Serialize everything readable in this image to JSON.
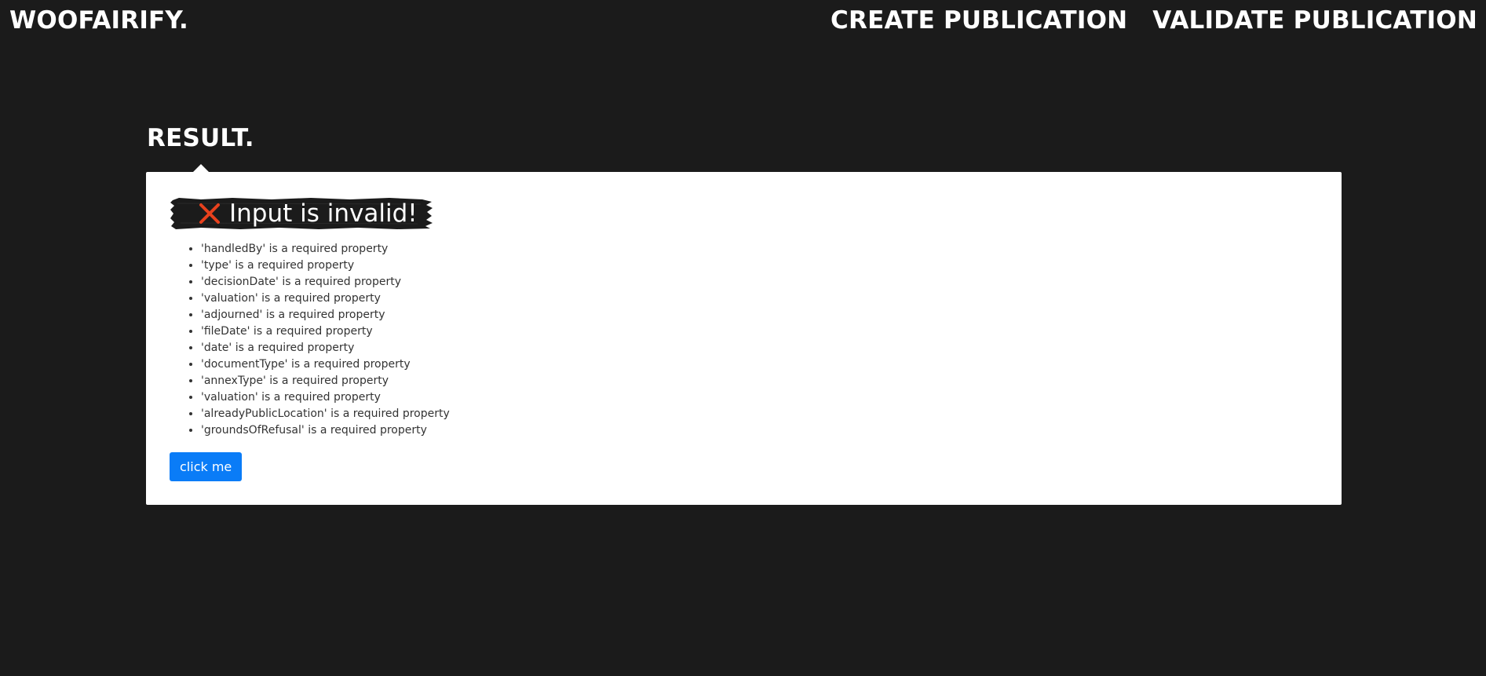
{
  "app": {
    "brand": "WOOFAIRIFY."
  },
  "nav": {
    "items": [
      {
        "label": "CREATE PUBLICATION"
      },
      {
        "label": "VALIDATE PUBLICATION"
      }
    ]
  },
  "result": {
    "heading": "RESULT.",
    "status": {
      "icon": "cross-icon",
      "text": "Input is invalid!",
      "icon_color": "#e8411d"
    },
    "errors": [
      "'handledBy' is a required property",
      "'type' is a required property",
      "'decisionDate' is a required property",
      "'valuation' is a required property",
      "'adjourned' is a required property",
      "'fileDate' is a required property",
      "'date' is a required property",
      "'documentType' is a required property",
      "'annexType' is a required property",
      "'valuation' is a required property",
      "'alreadyPublicLocation' is a required property",
      "'groundsOfRefusal' is a required property"
    ],
    "button_label": "click me"
  },
  "colors": {
    "background": "#1b1b1b",
    "card": "#ffffff",
    "button": "#0a7cf7",
    "banner": "#1b1b1b"
  }
}
